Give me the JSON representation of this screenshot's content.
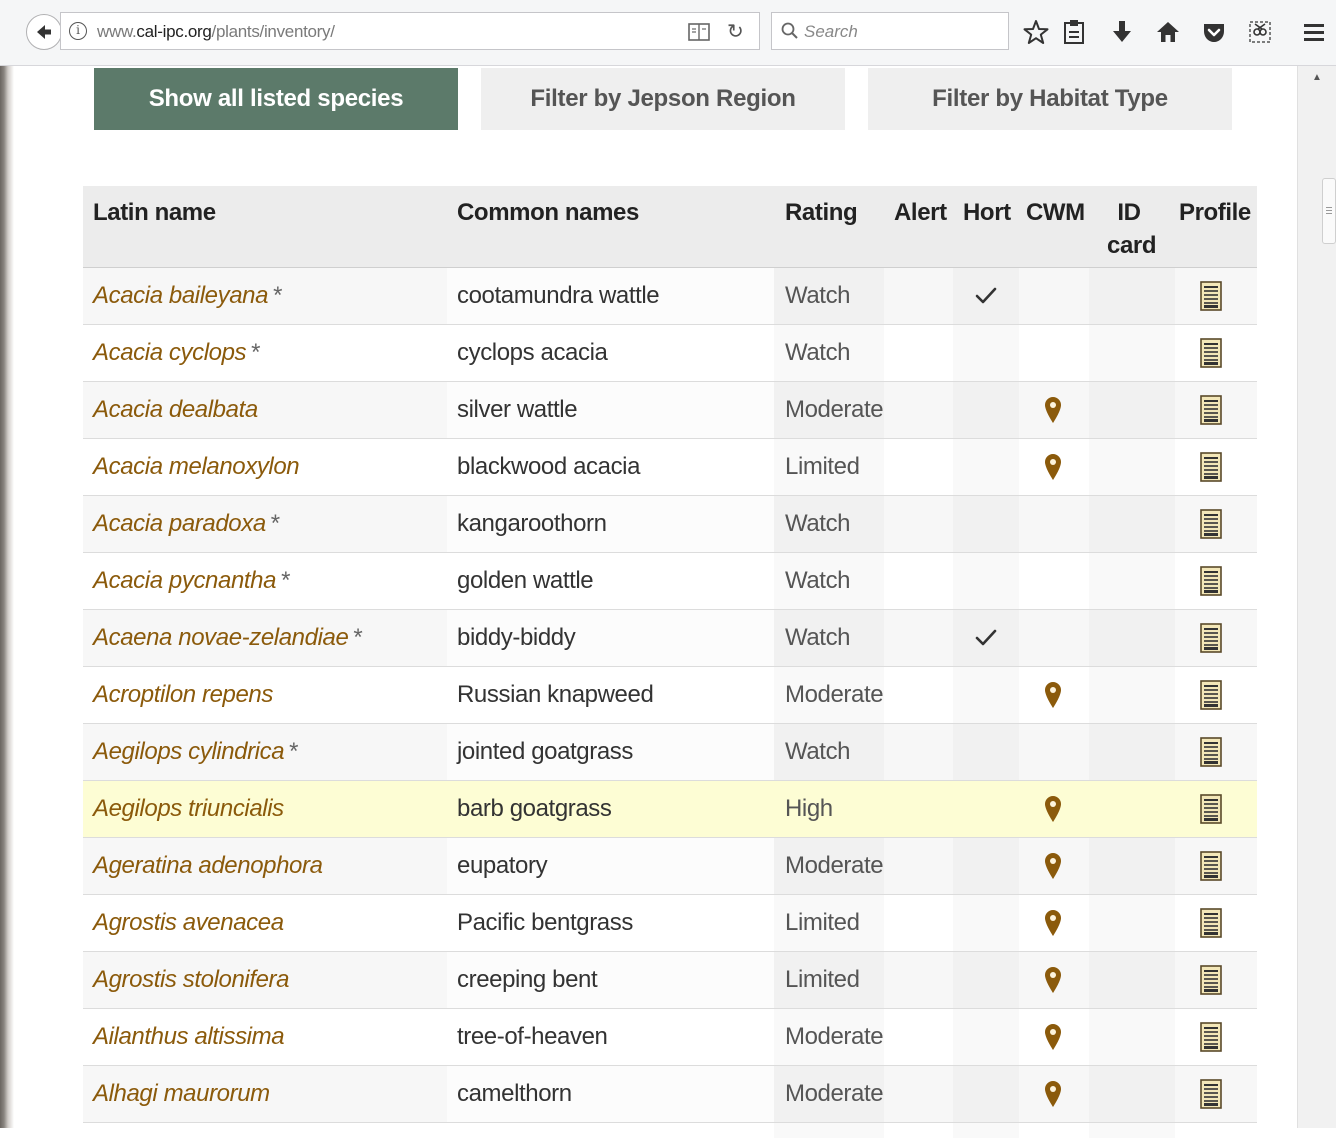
{
  "browser": {
    "url_host": "www.cal-ipc.org",
    "url_path": "/plants/inventory/",
    "url_prefix": "www.",
    "search_placeholder": "Search"
  },
  "tabs": [
    {
      "label": "Show all listed species",
      "active": true
    },
    {
      "label": "Filter by Jepson Region",
      "active": false
    },
    {
      "label": "Filter by Habitat Type",
      "active": false
    }
  ],
  "table": {
    "headers": {
      "latin": "Latin name",
      "common": "Common names",
      "rating": "Rating",
      "alert": "Alert",
      "hort": "Hort",
      "cwm": "CWM",
      "id_card_line1": "ID",
      "id_card_line2": "card",
      "profile": "Profile"
    },
    "rows": [
      {
        "latin": "Acacia baileyana",
        "star": "*",
        "common": "cootamundra wattle",
        "rating": "Watch",
        "hort": true,
        "cwm": false
      },
      {
        "latin": "Acacia cyclops",
        "star": "*",
        "common": "cyclops acacia",
        "rating": "Watch",
        "hort": false,
        "cwm": false
      },
      {
        "latin": "Acacia dealbata",
        "star": "",
        "common": "silver wattle",
        "rating": "Moderate",
        "hort": false,
        "cwm": true
      },
      {
        "latin": "Acacia melanoxylon",
        "star": "",
        "common": "blackwood acacia",
        "rating": "Limited",
        "hort": false,
        "cwm": true
      },
      {
        "latin": "Acacia paradoxa",
        "star": "*",
        "common": "kangaroothorn",
        "rating": "Watch",
        "hort": false,
        "cwm": false
      },
      {
        "latin": "Acacia pycnantha",
        "star": "*",
        "common": "golden wattle",
        "rating": "Watch",
        "hort": false,
        "cwm": false
      },
      {
        "latin": "Acaena novae-zelandiae",
        "star": "*",
        "common": "biddy-biddy",
        "rating": "Watch",
        "hort": true,
        "cwm": false
      },
      {
        "latin": "Acroptilon repens",
        "star": "",
        "common": "Russian knapweed",
        "rating": "Moderate",
        "hort": false,
        "cwm": true
      },
      {
        "latin": "Aegilops cylindrica",
        "star": "*",
        "common": "jointed goatgrass",
        "rating": "Watch",
        "hort": false,
        "cwm": false
      },
      {
        "latin": "Aegilops triuncialis",
        "star": "",
        "common": "barb goatgrass",
        "rating": "High",
        "hort": false,
        "cwm": true,
        "highlight": true
      },
      {
        "latin": "Ageratina adenophora",
        "star": "",
        "common": "eupatory",
        "rating": "Moderate",
        "hort": false,
        "cwm": true
      },
      {
        "latin": "Agrostis avenacea",
        "star": "",
        "common": "Pacific bentgrass",
        "rating": "Limited",
        "hort": false,
        "cwm": true
      },
      {
        "latin": "Agrostis stolonifera",
        "star": "",
        "common": "creeping bent",
        "rating": "Limited",
        "hort": false,
        "cwm": true
      },
      {
        "latin": "Ailanthus altissima",
        "star": "",
        "common": "tree-of-heaven",
        "rating": "Moderate",
        "hort": false,
        "cwm": true
      },
      {
        "latin": "Alhagi maurorum",
        "star": "",
        "common": "camelthorn",
        "rating": "Moderate",
        "hort": false,
        "cwm": true
      }
    ]
  },
  "colors": {
    "accent_green": "#5c7a6a",
    "latin_brown": "#8b5a0b",
    "marker_brown": "#8b5a0b",
    "highlight_yellow": "#fdfdd4"
  },
  "icons": {
    "hort": "check-icon",
    "cwm": "map-marker-icon",
    "profile": "document-icon"
  }
}
